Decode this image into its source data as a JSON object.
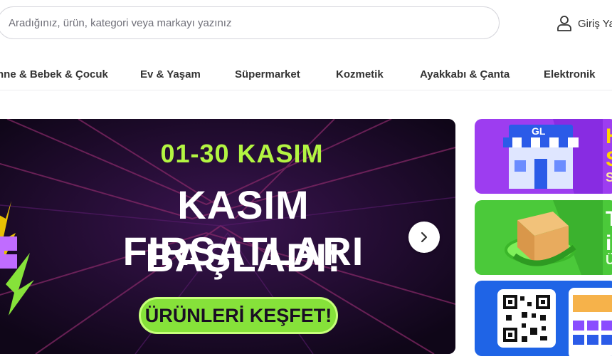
{
  "header": {
    "search_placeholder": "Aradığınız, ürün, kategori veya markayı yazınız",
    "login_label": "Giriş Ya"
  },
  "category_nav": [
    "nne & Bebek & Çocuk",
    "Ev & Yaşam",
    "Süpermarket",
    "Kozmetik",
    "Ayakkabı & Çanta",
    "Elektronik"
  ],
  "banner": {
    "date": "01-30 KASIM",
    "title_line1": "KASIM FIRSATLARI",
    "title_line2": "BAŞLADI!",
    "cta": "ÜRÜNLERİ KEŞFET!",
    "side_letters": "E"
  },
  "side_cards": [
    {
      "store_sign": "GL",
      "text_lines": [
        "H",
        "S",
        "S"
      ],
      "color": "#9d3df0"
    },
    {
      "text_lines": [
        "T",
        "i",
        "Ü"
      ],
      "color": "#4bc93a"
    },
    {
      "color": "#1f64e6"
    }
  ],
  "colors": {
    "accent_green": "#86e23a",
    "date_green": "#b3f542",
    "banner_bg": "#14081f"
  },
  "icons": {
    "login": "user-icon",
    "next": "chevron-right-icon",
    "store": "store-icon",
    "package": "package-icon",
    "qr": "qr-code-icon"
  }
}
